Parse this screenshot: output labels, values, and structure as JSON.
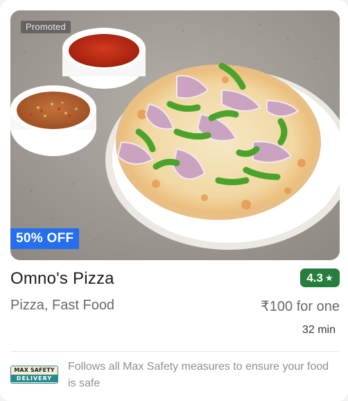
{
  "restaurant": {
    "promoted_label": "Promoted",
    "offer_label": "50% OFF",
    "name": "Omno's Pizza",
    "rating": "4.3",
    "cuisine": "Pizza, Fast Food",
    "price": "₹100 for one",
    "delivery_time": "32 min",
    "image_icon": "pizza-photo"
  },
  "safety": {
    "logo_top": "MAX SAFETY",
    "logo_bottom": "DELIVERY",
    "message": "Follows all Max Safety measures to ensure your food is safe"
  },
  "colors": {
    "offer_badge": "#256fef",
    "rating_badge": "#267e3e",
    "safety_teal": "#2a8a8a"
  }
}
